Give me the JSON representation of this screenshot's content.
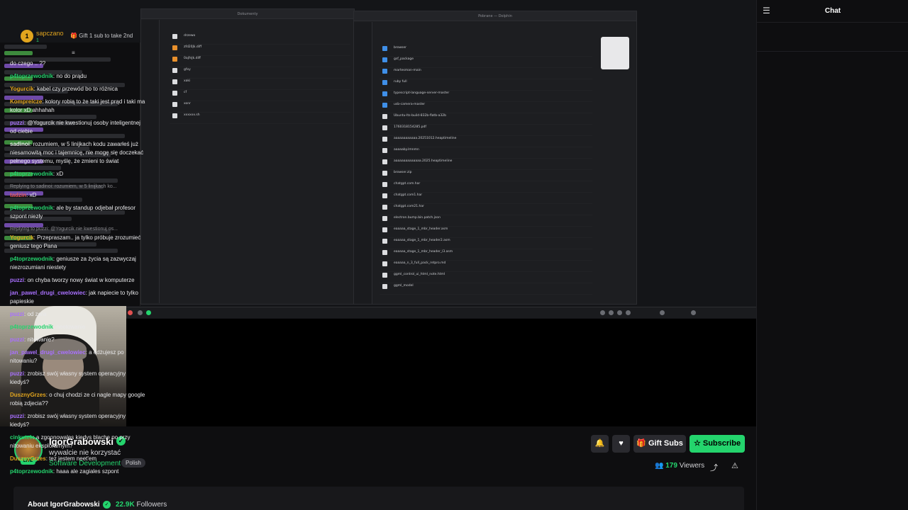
{
  "channel": {
    "name": "IgorGrabowski",
    "title": "wywalcie nie korzystać",
    "category": "Software Development",
    "tag": "Polish",
    "live_label": "LIVE",
    "viewers": "179",
    "viewers_label": "Viewers",
    "followers": "22.9K",
    "followers_label": "Followers",
    "about": "About IgorGrabowski"
  },
  "actions": {
    "gift": "Gift Subs",
    "subscribe": "Subscribe"
  },
  "chat": {
    "title": "Chat",
    "pinned": {
      "user": "sapczano",
      "count": "1",
      "text": "Gift 1 sub to take 2nd"
    },
    "messages": [
      {
        "user": "",
        "color": "#ffffff",
        "text": "do czego .. ??"
      },
      {
        "user": "p4toprzewodnik",
        "color": "#24d46d",
        "text": "no do prądu"
      },
      {
        "user": "Yogurcik",
        "color": "#e2a51e",
        "text": "kabel czy przewód bo to różnica"
      },
      {
        "user": "Komprelcze",
        "color": "#e2a51e",
        "text": "kolory robią to że taki jest prąd i taki ma kolor xD ahhahah"
      },
      {
        "user": "puzzi",
        "color": "#a970ff",
        "text": "@Yogurcik nie kwestionuj osoby inteligentnej od ciebie"
      },
      {
        "user": "sadinoi",
        "color": "#e8e8ea",
        "text": "rozumiem, w 5 linijkach kodu zawarłeś już niesamowitą moc i tajemnicę, nie mogę się doczekać pełnego systemu, myślę, że zmieni to świat"
      },
      {
        "user": "p4toprzewodnik",
        "color": "#24d46d",
        "text": "xD"
      },
      {
        "reply": "Replying to sadinoi: rozumiem, w 5 linijkach ko...",
        "user": "tadzin",
        "color": "#e05a5a",
        "text": "xD"
      },
      {
        "user": "p4toprzewodnik",
        "color": "#24d46d",
        "text": "ale by standup odjebał profesor szpont niezły"
      },
      {
        "reply": "Replying to puzzi: @Yogurcik nie kwestionuj os...",
        "user": "Yogurcik",
        "color": "#e2a51e",
        "text": "Przepraszam.. ja tylko próbuje zrozumieć geniusz tego Pana"
      },
      {
        "user": "p4toprzewodnik",
        "color": "#24d46d",
        "text": "geniusze za życia są zazwyczaj niezrozumiani niestety"
      },
      {
        "user": "puzzi",
        "color": "#a970ff",
        "text": "on chyba tworzy nowy świat w komputerze"
      },
      {
        "user": "jan_pawel_drugi_cwelowiec",
        "color": "#a970ff",
        "text": "jak napiecie to tylko papieskie"
      },
      {
        "user": "puzzi",
        "color": "#a970ff",
        "text": "od zera"
      },
      {
        "user": "p4toprzewodnik",
        "color": "#24d46d",
        "text": "neetowanie"
      },
      {
        "user": "puzzi",
        "color": "#a970ff",
        "text": "nitowanie?"
      },
      {
        "user": "jan_pawel_drugi_cwelowiec",
        "color": "#a970ff",
        "text": "a edżujesz po nitowaniu?"
      },
      {
        "user": "puzzi",
        "color": "#a970ff",
        "text": "zrobisz swój własny system operacyjny kiedyś?"
      },
      {
        "user": "DusznyGrzes",
        "color": "#e2a51e",
        "text": "o chuj chodzi ze ci nagle mapy google robią zdjecia??"
      },
      {
        "user": "puzzi",
        "color": "#a970ff",
        "text": "zrobisz swój własny system operacyjny kiedyś?"
      },
      {
        "user": "cinkutek",
        "color": "#24d46d",
        "text": "a zgoonowales kiedys blache po przy nitowaniu eksplorarnym?"
      },
      {
        "user": "DusznyGrzes",
        "color": "#e2a51e",
        "text": "tez jestem neet'em"
      },
      {
        "user": "p4toprzewodnik",
        "color": "#24d46d",
        "text": "haaa ale zagiales szpont"
      }
    ]
  },
  "desktop": {
    "left_window_title": "Dokumenty",
    "right_window_title": "Pobrane — Dolphin",
    "left_files": [
      "drzewo",
      "zfd20Jk.diff",
      "0ajfnJk.diff",
      "gfxy",
      "xaki",
      "cf",
      "xonr",
      "xxxxxx.sh"
    ],
    "right_files": [
      "browser",
      "gsf_package",
      "martesman-main",
      "ruby full",
      "typescript-language-server-master",
      "usb-camera-master",
      "Ubuntu-lts-build-832b-flatb-a32b",
      "1760318154285.pdf",
      "aaaaaaaaaaaa.20251012.heaptimeline",
      "aaaaaby.lmnmn",
      "aaaaaaaaaaaaaa.2025.heaptimeline",
      "browser.zip",
      "chatgpt.com.har",
      "chatgpt.com1.har",
      "chatgpt.com21.har",
      "electron.bump.bin.patch.json",
      "eaaaaa_stage_1_mbr_header.asm",
      "eaaaaa_stage_1_mbr_header2.asm",
      "eaaaaa_stage_1_mbr_header_l3.asm",
      "eaaaaa_n_3_full_pack_retpro.md",
      "ggml_control_ui_html_note.html",
      "ggml_model"
    ]
  },
  "colors": {
    "brand": "#24d46d",
    "background": "#0e0e10"
  }
}
